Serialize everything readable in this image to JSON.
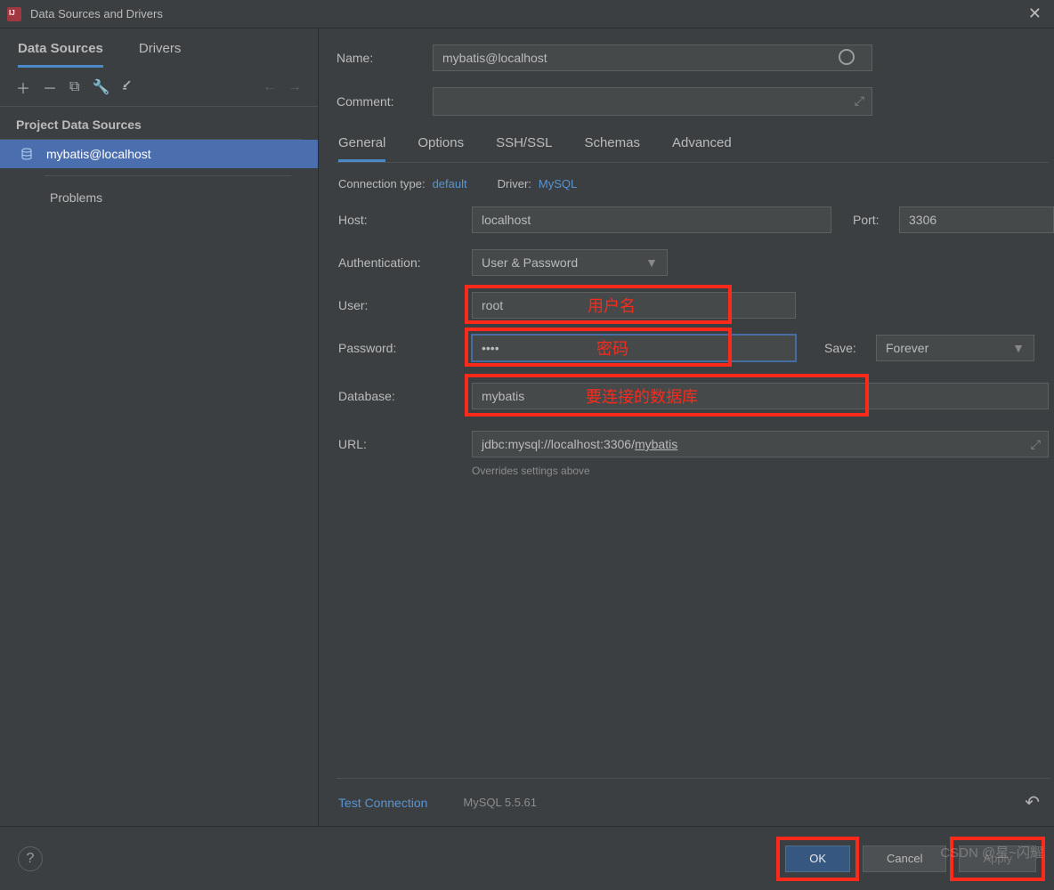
{
  "window": {
    "title": "Data Sources and Drivers"
  },
  "sidebar": {
    "tabs": [
      "Data Sources",
      "Drivers"
    ],
    "section": "Project Data Sources",
    "items": [
      {
        "label": "mybatis@localhost"
      }
    ],
    "problems": "Problems"
  },
  "form": {
    "name_label": "Name:",
    "name_value": "mybatis@localhost",
    "comment_label": "Comment:",
    "tabs": [
      "General",
      "Options",
      "SSH/SSL",
      "Schemas",
      "Advanced"
    ],
    "conn_type_label": "Connection type:",
    "conn_type_value": "default",
    "driver_label": "Driver:",
    "driver_value": "MySQL",
    "host_label": "Host:",
    "host_value": "localhost",
    "port_label": "Port:",
    "port_value": "3306",
    "auth_label": "Authentication:",
    "auth_value": "User & Password",
    "user_label": "User:",
    "user_value": "root",
    "pass_label": "Password:",
    "pass_value": "••••",
    "save_label": "Save:",
    "save_value": "Forever",
    "db_label": "Database:",
    "db_value": "mybatis",
    "url_label": "URL:",
    "url_prefix": "jdbc:mysql://localhost:3306/",
    "url_db": "mybatis",
    "url_hint": "Overrides settings above",
    "test_conn": "Test Connection",
    "db_version": "MySQL 5.5.61"
  },
  "annotations": {
    "user": "用户名",
    "pass": "密码",
    "db": "要连接的数据库"
  },
  "footer": {
    "ok": "OK",
    "cancel": "Cancel",
    "apply": "Apply"
  },
  "watermark": "CSDN @星~闪耀"
}
